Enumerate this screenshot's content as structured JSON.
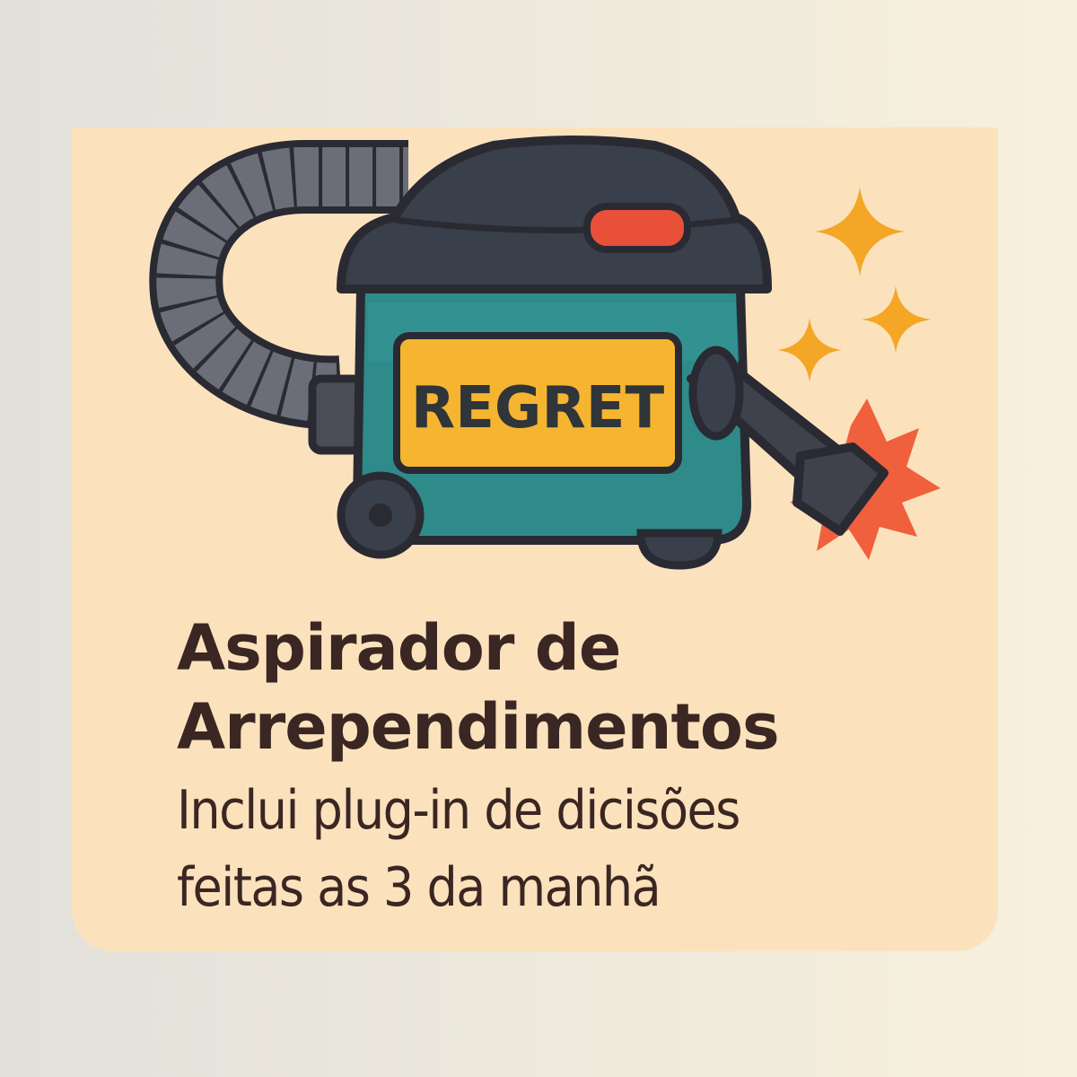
{
  "card": {
    "label": "REGRET",
    "title_line1": "Aspirador de",
    "title_line2": "Arrependimentos",
    "subtitle_line1": "Inclui plug-in de dicisões",
    "subtitle_line2": "feitas as 3 da manhã"
  },
  "colors": {
    "background_left": "#e2e0db",
    "background_right": "#f8f0dc",
    "card": "#fbe2bd",
    "text": "#3a2622",
    "vacuum_body": "#2f8a8a",
    "vacuum_lid": "#3a3f4c",
    "label_bg": "#f6b530",
    "sparkle": "#f4a626",
    "burst": "#f0603d",
    "button": "#e8503a"
  },
  "icons": [
    "vacuum-cleaner-icon",
    "sparkle-icon",
    "burst-icon"
  ]
}
